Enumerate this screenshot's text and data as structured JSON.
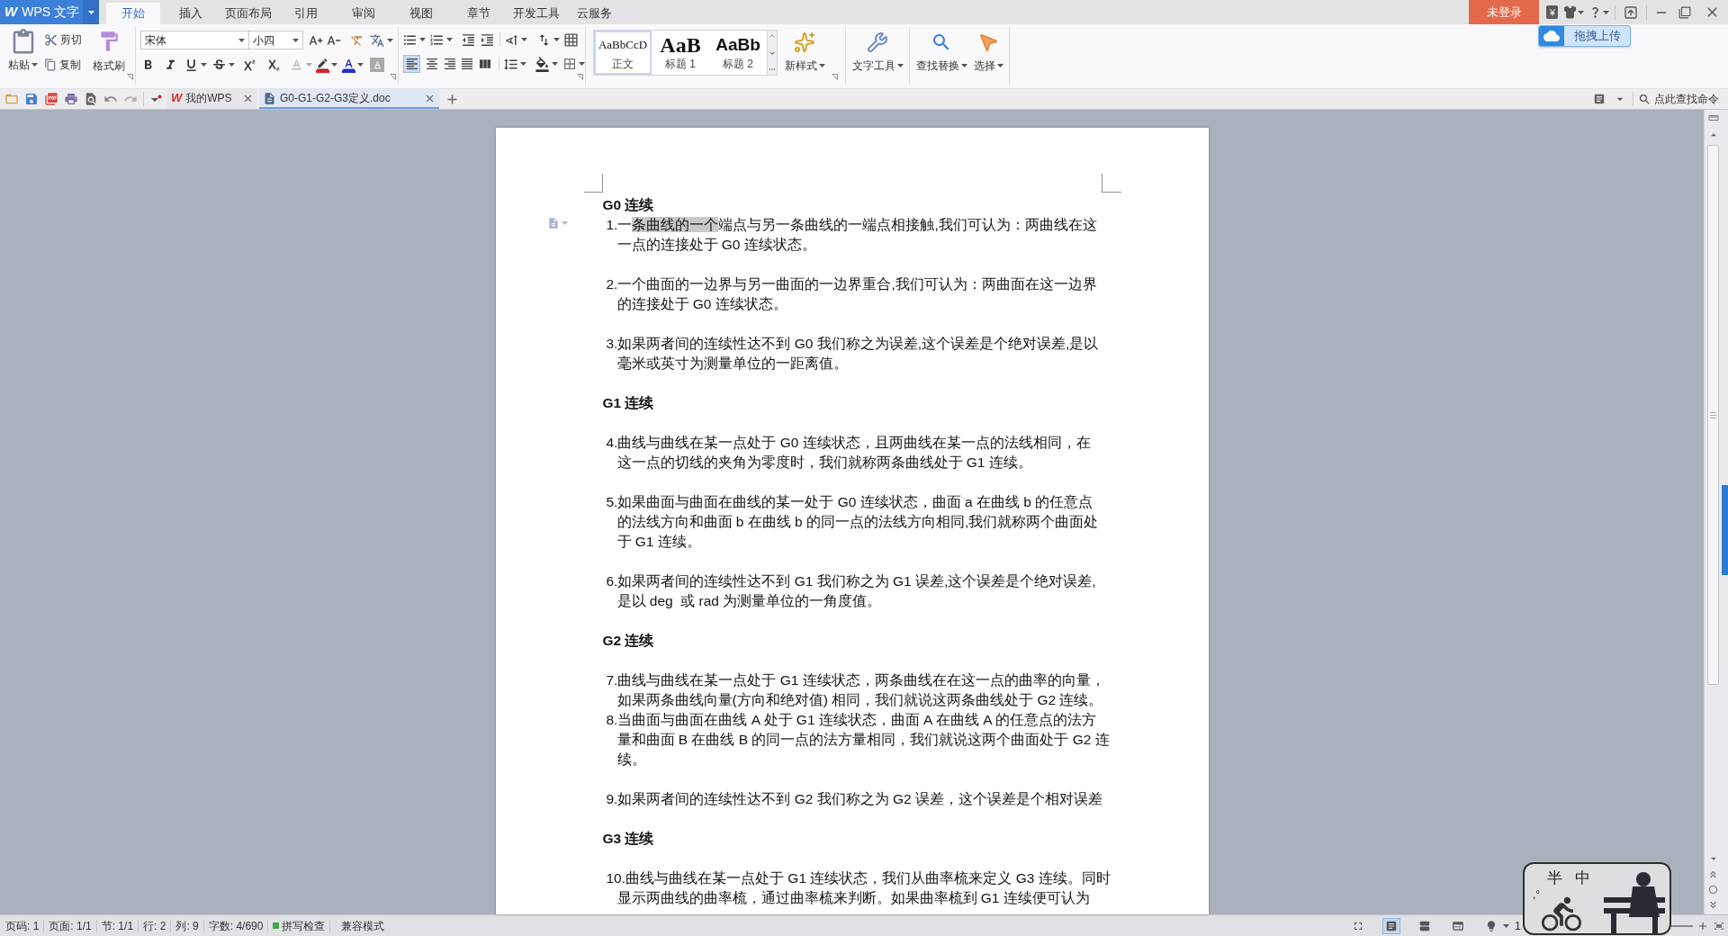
{
  "app_menu": {
    "logo": "W",
    "label": "WPS 文字"
  },
  "ribbon_tabs": [
    {
      "label": "开始",
      "selected": true
    },
    {
      "label": "插入",
      "selected": false
    },
    {
      "label": "页面布局",
      "selected": false
    },
    {
      "label": "引用",
      "selected": false
    },
    {
      "label": "审阅",
      "selected": false
    },
    {
      "label": "视图",
      "selected": false
    },
    {
      "label": "章节",
      "selected": false
    },
    {
      "label": "开发工具",
      "selected": false
    },
    {
      "label": "云服务",
      "selected": false
    }
  ],
  "account_button": {
    "label": "未登录"
  },
  "upload_button": {
    "label": "拖拽上传"
  },
  "ribbon": {
    "clipboard": {
      "paste": "粘贴",
      "cut": "剪切",
      "copy": "复制",
      "format_painter": "格式刷"
    },
    "font": {
      "name": "宋体",
      "size": "小四"
    },
    "alignment": [
      {
        "kind": "left",
        "selected": true
      },
      {
        "kind": "center",
        "selected": false
      },
      {
        "kind": "right",
        "selected": false
      },
      {
        "kind": "justify",
        "selected": false
      },
      {
        "kind": "distributed",
        "selected": false
      }
    ],
    "styles": [
      {
        "kind": "body",
        "preview": "AaBbCcD",
        "label": "正文",
        "selected": true
      },
      {
        "kind": "heading1",
        "preview": "AaB",
        "label": "标题 1",
        "selected": false
      },
      {
        "kind": "heading2",
        "preview": "AaBb",
        "label": "标题 2",
        "selected": false
      }
    ],
    "tool_groups": [
      {
        "buttons": [
          {
            "kind": "new_style",
            "label": "新样式"
          }
        ]
      },
      {
        "buttons": [
          {
            "kind": "text_tools",
            "label": "文字工具"
          }
        ]
      },
      {
        "buttons": [
          {
            "kind": "find_replace",
            "label": "查找替换"
          },
          {
            "kind": "select",
            "label": "选择"
          }
        ]
      }
    ]
  },
  "doc_tabs": [
    {
      "kind": "home",
      "logo": "W",
      "label": "我的WPS",
      "selected": false
    },
    {
      "kind": "document",
      "label": "G0-G1-G2-G3定义.doc",
      "selected": true
    }
  ],
  "command_search": {
    "placeholder": "点此查找命令"
  },
  "document": {
    "blocks": [
      {
        "kind": "heading",
        "text": "G0 连续"
      },
      {
        "kind": "paragraph",
        "lines": [
          [
            {
              "text": "1.一",
              "selected": false
            },
            {
              "text": "条曲线的一个",
              "selected": true
            },
            {
              "text": "端点与另一条曲线的一端点相接触,我们可认为：两曲线在这",
              "selected": false
            }
          ],
          [
            {
              "text": "一点的连接处于 G0 连续状态。",
              "selected": false
            }
          ]
        ]
      },
      {
        "kind": "empty_line"
      },
      {
        "kind": "paragraph",
        "lines": [
          [
            {
              "text": "2.一个曲面的一边界与另一曲面的一边界重合,我们可认为：两曲面在这一边界",
              "selected": false
            }
          ],
          [
            {
              "text": "的连接处于 G0 连续状态。",
              "selected": false
            }
          ]
        ]
      },
      {
        "kind": "empty_line"
      },
      {
        "kind": "paragraph",
        "lines": [
          [
            {
              "text": "3.如果两者间的连续性达不到 G0 我们称之为误差,这个误差是个绝对误差,是以",
              "selected": false
            }
          ],
          [
            {
              "text": "毫米或英寸为测量单位的一距离值。",
              "selected": false
            }
          ]
        ]
      },
      {
        "kind": "empty_line"
      },
      {
        "kind": "heading",
        "text": "G1 连续"
      },
      {
        "kind": "empty_line"
      },
      {
        "kind": "paragraph",
        "lines": [
          [
            {
              "text": "4.曲线与曲线在某一点处于 G0 连续状态，且两曲线在某一点的法线相同，在",
              "selected": false
            }
          ],
          [
            {
              "text": "这一点的切线的夹角为零度时，我们就称两条曲线处于 G1 连续。",
              "selected": false
            }
          ]
        ]
      },
      {
        "kind": "empty_line"
      },
      {
        "kind": "paragraph",
        "lines": [
          [
            {
              "text": "5.如果曲面与曲面在曲线的某一处于 G0 连续状态，曲面 a 在曲线 b 的任意点",
              "selected": false
            }
          ],
          [
            {
              "text": "的法线方向和曲面 b 在曲线 b 的同一点的法线方向相同,我们就称两个曲面处",
              "selected": false
            }
          ],
          [
            {
              "text": "于 G1 连续。",
              "selected": false
            }
          ]
        ]
      },
      {
        "kind": "empty_line"
      },
      {
        "kind": "paragraph",
        "lines": [
          [
            {
              "text": "6.如果两者间的连续性达不到 G1 我们称之为 G1 误差,这个误差是个绝对误差,",
              "selected": false
            }
          ],
          [
            {
              "text": "是以 deg  或 rad 为测量单位的一角度值。",
              "selected": false
            }
          ]
        ]
      },
      {
        "kind": "empty_line"
      },
      {
        "kind": "heading",
        "text": "G2 连续"
      },
      {
        "kind": "empty_line"
      },
      {
        "kind": "paragraph",
        "lines": [
          [
            {
              "text": "7.曲线与曲线在某一点处于 G1 连续状态，两条曲线在在这一点的曲率的向量，",
              "selected": false
            }
          ],
          [
            {
              "text": "如果两条曲线向量(方向和绝对值) 相同，我们就说这两条曲线处于 G2 连续。",
              "selected": false
            }
          ]
        ]
      },
      {
        "kind": "paragraph",
        "lines": [
          [
            {
              "text": "8.当曲面与曲面在曲线 A 处于 G1 连续状态，曲面 A 在曲线 A 的任意点的法方",
              "selected": false
            }
          ],
          [
            {
              "text": "量和曲面 B 在曲线 B 的同一点的法方量相同，我们就说这两个曲面处于 G2 连",
              "selected": false
            }
          ],
          [
            {
              "text": "续。",
              "selected": false
            }
          ]
        ]
      },
      {
        "kind": "empty_line"
      },
      {
        "kind": "paragraph",
        "lines": [
          [
            {
              "text": "9.如果两者间的连续性达不到 G2 我们称之为 G2 误差，这个误差是个相对误差",
              "selected": false
            }
          ]
        ]
      },
      {
        "kind": "empty_line"
      },
      {
        "kind": "heading",
        "text": "G3 连续"
      },
      {
        "kind": "empty_line"
      },
      {
        "kind": "paragraph",
        "lines": [
          [
            {
              "text": "10.曲线与曲线在某一点处于 G1 连续状态，我们从曲率梳来定义 G3 连续。同时",
              "selected": false
            }
          ],
          [
            {
              "text": "显示两曲线的曲率梳，通过曲率梳来判断。如果曲率梳到 G1 连续便可认为",
              "selected": false
            }
          ]
        ]
      }
    ]
  },
  "status_bar": {
    "items": [
      "页码: 1",
      "页面: 1/1",
      "节: 1/1",
      "行: 2",
      "列: 9",
      "字数: 4/690"
    ],
    "spell_check": {
      "label": "拼写检查",
      "on": true
    },
    "mode": "兼容模式",
    "views": [
      {
        "kind": "full_screen",
        "selected": false
      },
      {
        "kind": "page",
        "selected": true
      },
      {
        "kind": "outline",
        "selected": false
      },
      {
        "kind": "web",
        "selected": false
      },
      {
        "kind": "read",
        "selected": false
      }
    ],
    "zoom_percent": "1"
  },
  "ime": {
    "width_mode": "半",
    "language_mode": "中",
    "punctuation_mode": ",°"
  }
}
